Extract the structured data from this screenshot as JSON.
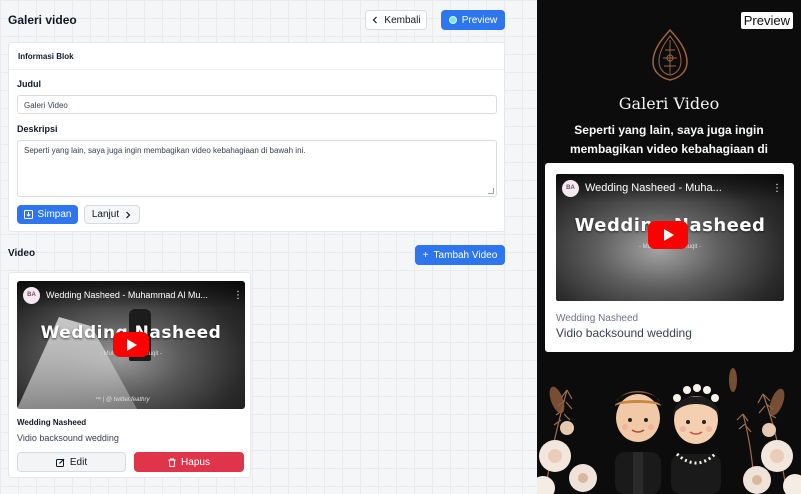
{
  "header": {
    "title": "Galeri video",
    "back_label": "Kembali",
    "preview_label": "Preview"
  },
  "info_block": {
    "heading": "Informasi Blok",
    "title_label": "Judul",
    "title_value": "Galeri Video",
    "desc_label": "Deskripsi",
    "desc_value": "Seperti yang lain, saya juga ingin membagikan video kebahagiaan di bawah ini.",
    "save_label": "Simpan",
    "next_label": "Lanjut"
  },
  "video_section": {
    "title": "Video",
    "add_label": "Tambah Video",
    "items": [
      {
        "youtube_title": "Wedding Nasheed - Muhammad Al Mu...",
        "channel_avatar": "BA",
        "thumb_text": "Wedding Nasheed",
        "thumb_sub": "- Muhammad Al Muqit -",
        "thumb_sig": "™ | @ twitter.feathry",
        "name": "Wedding Nasheed",
        "description": "Vidio backsound wedding",
        "edit_label": "Edit",
        "delete_label": "Hapus"
      }
    ]
  },
  "preview": {
    "tag": "Preview",
    "title": "Galeri Video",
    "description": "Seperti yang lain, saya juga ingin membagikan video kebahagiaan di bawah ini.",
    "youtube_title": "Wedding Nasheed - Muha...",
    "channel_avatar": "BA",
    "thumb_text": "Wedding Nasheed",
    "thumb_sub": "- Muhammad Al Muqit -",
    "video_name": "Wedding Nasheed",
    "video_desc": "Vidio backsound wedding"
  },
  "colors": {
    "primary": "#2e75f0",
    "danger": "#e0344a",
    "preview_bg": "#0c0c0c",
    "gold": "#a0643c"
  },
  "icons": [
    "chevron-left-icon",
    "preview-dot-icon",
    "save-icon",
    "chevron-right-icon",
    "plus-icon",
    "edit-icon",
    "trash-icon",
    "play-icon",
    "more-vertical-icon",
    "gunungan-ornament-icon"
  ]
}
